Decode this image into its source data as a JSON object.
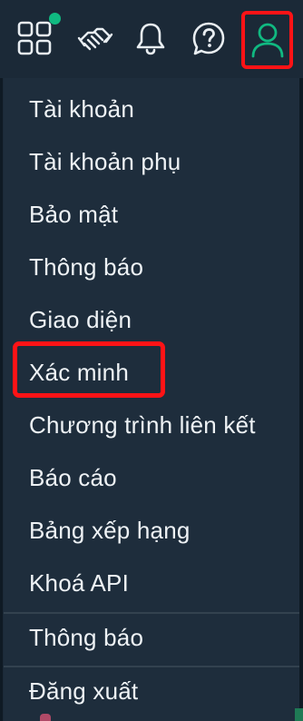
{
  "header": {
    "icons": {
      "apps": "grid-apps-icon",
      "handshake": "handshake-icon",
      "bell": "bell-icon",
      "help": "help-icon",
      "user": "user-icon"
    },
    "notification_dot_color": "#10b981",
    "user_icon_color": "#10b981",
    "highlight_color": "#ff1316"
  },
  "menu": {
    "items": [
      {
        "label": "Tài khoản"
      },
      {
        "label": "Tài khoản phụ"
      },
      {
        "label": "Bảo mật"
      },
      {
        "label": "Thông báo"
      },
      {
        "label": "Giao diện"
      },
      {
        "label": "Xác minh"
      },
      {
        "label": "Chương trình liên kết"
      },
      {
        "label": "Báo cáo"
      },
      {
        "label": "Bảng xếp hạng"
      },
      {
        "label": "Khoá API"
      },
      {
        "label": "Thông báo"
      },
      {
        "label": "Đăng xuất"
      }
    ]
  }
}
